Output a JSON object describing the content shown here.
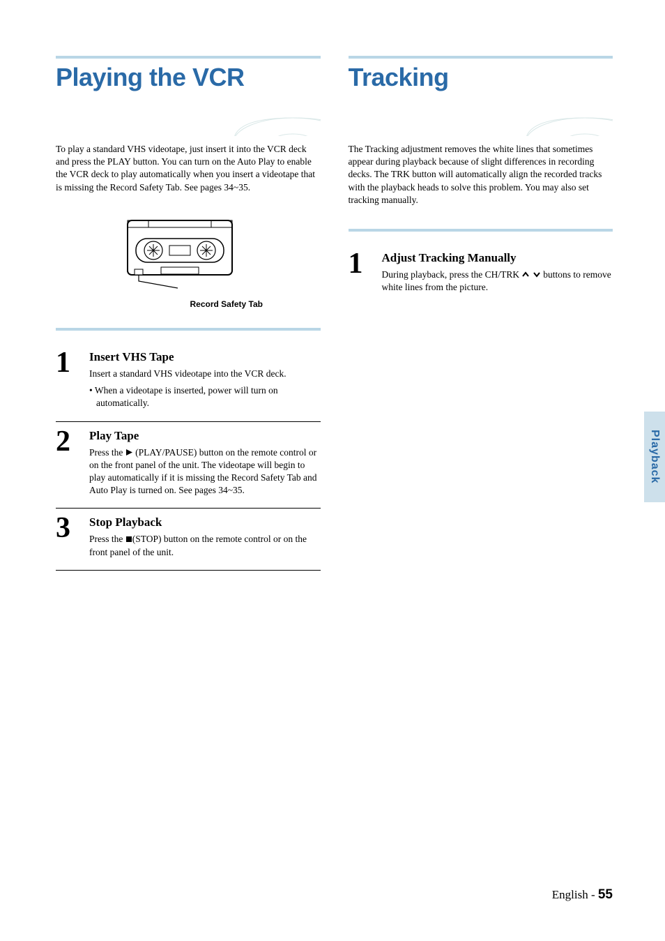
{
  "left": {
    "title": "Playing the VCR",
    "intro": "To play a standard VHS videotape, just insert it into the VCR deck and press the PLAY button. You can turn on the Auto Play to enable the VCR deck to play automatically when you insert a videotape that is missing the Record Safety Tab. See pages 34~35.",
    "tape_caption": "Record Safety Tab",
    "steps": [
      {
        "num": "1",
        "title": "Insert VHS Tape",
        "text": "Insert a standard VHS videotape into the VCR deck.",
        "bullet": "• When a videotape is inserted, power will turn on automatically."
      },
      {
        "num": "2",
        "title": "Play Tape",
        "text_before": "Press the ",
        "text_after": " (PLAY/PAUSE) button on the remote control or on the front panel of the unit. The videotape will begin to play automatically if it is missing the Record Safety Tab and Auto Play is turned on. See pages 34~35."
      },
      {
        "num": "3",
        "title": "Stop Playback",
        "text_before": "Press the ",
        "text_after": "(STOP) button on the remote control or on the front panel of the unit."
      }
    ]
  },
  "right": {
    "title": "Tracking",
    "intro": "The Tracking adjustment removes the white lines that sometimes appear during playback because of slight differences in recording decks. The TRK button will automatically align the recorded tracks with the playback heads to solve this problem. You may also set tracking manually.",
    "step": {
      "num": "1",
      "title": "Adjust Tracking Manually",
      "text_before": "During playback, press the CH/TRK ",
      "text_after": " buttons to remove white lines from the picture."
    }
  },
  "side_tab": "Playback",
  "footer_lang": "English - ",
  "footer_page": "55"
}
